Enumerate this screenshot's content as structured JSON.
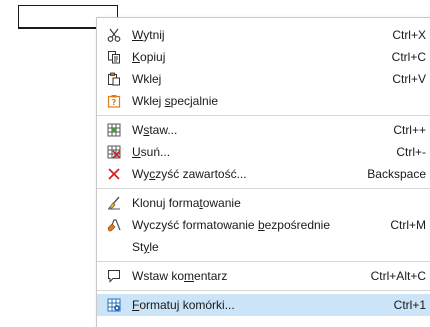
{
  "menu": {
    "items": [
      {
        "label_pre": "",
        "label_key": "W",
        "label_post": "ytnij",
        "shortcut": "Ctrl+X",
        "icon": "scissors-icon"
      },
      {
        "label_pre": "",
        "label_key": "K",
        "label_post": "opiuj",
        "shortcut": "Ctrl+C",
        "icon": "copy-icon"
      },
      {
        "label_pre": "Wkle",
        "label_key": "j",
        "label_post": "",
        "shortcut": "Ctrl+V",
        "icon": "paste-icon"
      },
      {
        "label_pre": "Wklej ",
        "label_key": "s",
        "label_post": "pecjalnie",
        "shortcut": "",
        "icon": "paste-special-icon"
      },
      {
        "label_pre": "W",
        "label_key": "s",
        "label_post": "taw...",
        "shortcut": "Ctrl++",
        "icon": "insert-cells-icon"
      },
      {
        "label_pre": "",
        "label_key": "U",
        "label_post": "suń...",
        "shortcut": "Ctrl+-",
        "icon": "delete-cells-icon"
      },
      {
        "label_pre": "Wy",
        "label_key": "c",
        "label_post": "zyść zawartość...",
        "shortcut": "Backspace",
        "icon": "clear-x-icon"
      },
      {
        "label_pre": "Klonuj forma",
        "label_key": "t",
        "label_post": "owanie",
        "shortcut": "",
        "icon": "clone-brush-icon"
      },
      {
        "label_pre": "Wyczyść formatowanie ",
        "label_key": "b",
        "label_post": "ezpośrednie",
        "shortcut": "Ctrl+M",
        "icon": "clear-format-icon"
      },
      {
        "label_pre": "St",
        "label_key": "y",
        "label_post": "le",
        "shortcut": "",
        "icon": ""
      },
      {
        "label_pre": "Wstaw ko",
        "label_key": "m",
        "label_post": "entarz",
        "shortcut": "Ctrl+Alt+C",
        "icon": "comment-icon"
      },
      {
        "label_pre": "",
        "label_key": "F",
        "label_post": "ormatuj komórki...",
        "shortcut": "Ctrl+1",
        "icon": "format-cells-icon"
      }
    ]
  },
  "colors": {
    "highlight": "#cce4f7",
    "red_x": "#d92020",
    "icon_blue": "#2a6ebb",
    "icon_green": "#3d9a3d",
    "icon_orange": "#e07b1a"
  }
}
